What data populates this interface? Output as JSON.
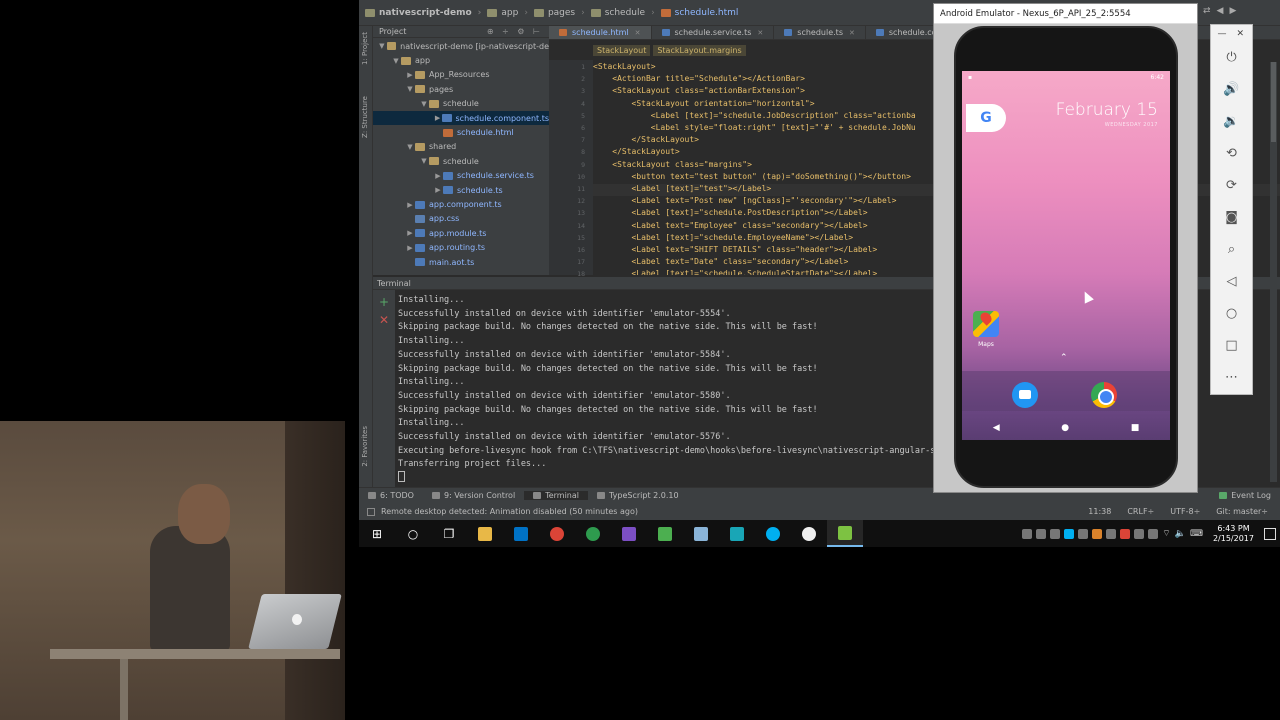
{
  "breadcrumbs": [
    "nativescript-demo",
    "app",
    "pages",
    "schedule",
    "schedule.html"
  ],
  "project_panel": {
    "title": "Project",
    "tree": [
      {
        "label": "nativescript-demo [ip-nativescript-de",
        "level": 0,
        "type": "folder",
        "arrow": "▼"
      },
      {
        "label": "app",
        "level": 1,
        "type": "folder",
        "arrow": "▼"
      },
      {
        "label": "App_Resources",
        "level": 2,
        "type": "folder",
        "arrow": "▶"
      },
      {
        "label": "pages",
        "level": 2,
        "type": "folder",
        "arrow": "▼"
      },
      {
        "label": "schedule",
        "level": 3,
        "type": "folder",
        "arrow": "▼"
      },
      {
        "label": "schedule.component.ts",
        "level": 4,
        "type": "ts",
        "arrow": "▶",
        "selected": true
      },
      {
        "label": "schedule.html",
        "level": 4,
        "type": "html",
        "arrow": ""
      },
      {
        "label": "shared",
        "level": 2,
        "type": "folder",
        "arrow": "▼"
      },
      {
        "label": "schedule",
        "level": 3,
        "type": "folder",
        "arrow": "▼"
      },
      {
        "label": "schedule.service.ts",
        "level": 4,
        "type": "ts",
        "arrow": "▶"
      },
      {
        "label": "schedule.ts",
        "level": 4,
        "type": "ts",
        "arrow": "▶"
      },
      {
        "label": "app.component.ts",
        "level": 2,
        "type": "ts",
        "arrow": "▶"
      },
      {
        "label": "app.css",
        "level": 2,
        "type": "css",
        "arrow": ""
      },
      {
        "label": "app.module.ts",
        "level": 2,
        "type": "ts",
        "arrow": "▶"
      },
      {
        "label": "app.routing.ts",
        "level": 2,
        "type": "ts",
        "arrow": "▶"
      },
      {
        "label": "main.aot.ts",
        "level": 2,
        "type": "ts",
        "arrow": ""
      }
    ]
  },
  "editor": {
    "tabs": [
      {
        "label": "schedule.html",
        "active": true
      },
      {
        "label": "schedule.service.ts",
        "active": false
      },
      {
        "label": "schedule.ts",
        "active": false
      },
      {
        "label": "schedule.component.ts",
        "active": false
      }
    ],
    "xml_breadcrumbs": [
      "StackLayout",
      "StackLayout.margins"
    ],
    "line_numbers": [
      "1",
      "2",
      "3",
      "4",
      "5",
      "6",
      "7",
      "8",
      "9",
      "10",
      "11",
      "12",
      "13",
      "14",
      "15",
      "16",
      "17",
      "18"
    ],
    "lines": [
      "<StackLayout>",
      "    <ActionBar title=\"Schedule\"></ActionBar>",
      "    <StackLayout class=\"actionBarExtension\">",
      "        <StackLayout orientation=\"horizontal\">",
      "            <Label [text]=\"schedule.JobDescription\" class=\"actionba",
      "            <Label style=\"float:right\" [text]=\"'#' + schedule.JobNu",
      "        </StackLayout>",
      "    </StackLayout>",
      "    <StackLayout class=\"margins\">",
      "        <button text=\"test button\" (tap)=\"doSomething()\"></button>",
      "        <Label [text]=\"test\"></Label>",
      "        <Label text=\"Post new\" [ngClass]=\"'secondary'\"></Label>",
      "        <Label [text]=\"schedule.PostDescription\"></Label>",
      "        <Label text=\"Employee\" class=\"secondary\"></Label>",
      "        <Label [text]=\"schedule.EmployeeName\"></Label>",
      "        <Label text=\"SHIFT DETAILS\" class=\"header\"></Label>",
      "        <Label text=\"Date\" class=\"secondary\"></Label>",
      "        <Label [text]=\"schedule.ScheduleStartDate\"></Label>"
    ]
  },
  "side_labels": {
    "project": "1: Project",
    "structure": "Z: Structure",
    "favorites": "2: Favorites"
  },
  "terminal": {
    "title": "Terminal",
    "lines": [
      "Installing...",
      "Successfully installed on device with identifier 'emulator-5554'.",
      "Skipping package build. No changes detected on the native side. This will be fast!",
      "Installing...",
      "Successfully installed on device with identifier 'emulator-5584'.",
      "Skipping package build. No changes detected on the native side. This will be fast!",
      "Installing...",
      "Successfully installed on device with identifier 'emulator-5580'.",
      "Skipping package build. No changes detected on the native side. This will be fast!",
      "Installing...",
      "Successfully installed on device with identifier 'emulator-5576'.",
      "Executing before-livesync hook from C:\\TFS\\nativescript-demo\\hooks\\before-livesync\\nativescript-angular-sy",
      "Transferring project files..."
    ]
  },
  "tool_windows": {
    "todo": "6: TODO",
    "version_control": "9: Version Control",
    "terminal": "Terminal",
    "typescript": "TypeScript 2.0.10",
    "event_log": "Event Log"
  },
  "status": {
    "message": "Remote desktop detected: Animation disabled (50 minutes ago)",
    "position": "11:38",
    "line_sep": "CRLF÷",
    "encoding": "UTF-8÷",
    "vcs": "Git: master÷"
  },
  "emulator": {
    "title": "Android Emulator - Nexus_6P_API_25_2:5554",
    "status_time": "6:42",
    "date": "February 15",
    "date_sub": "WEDNESDAY 2017",
    "google_glyph": "G",
    "maps_label": "Maps"
  },
  "taskbar": {
    "time": "6:43 PM",
    "date": "2/15/2017"
  }
}
